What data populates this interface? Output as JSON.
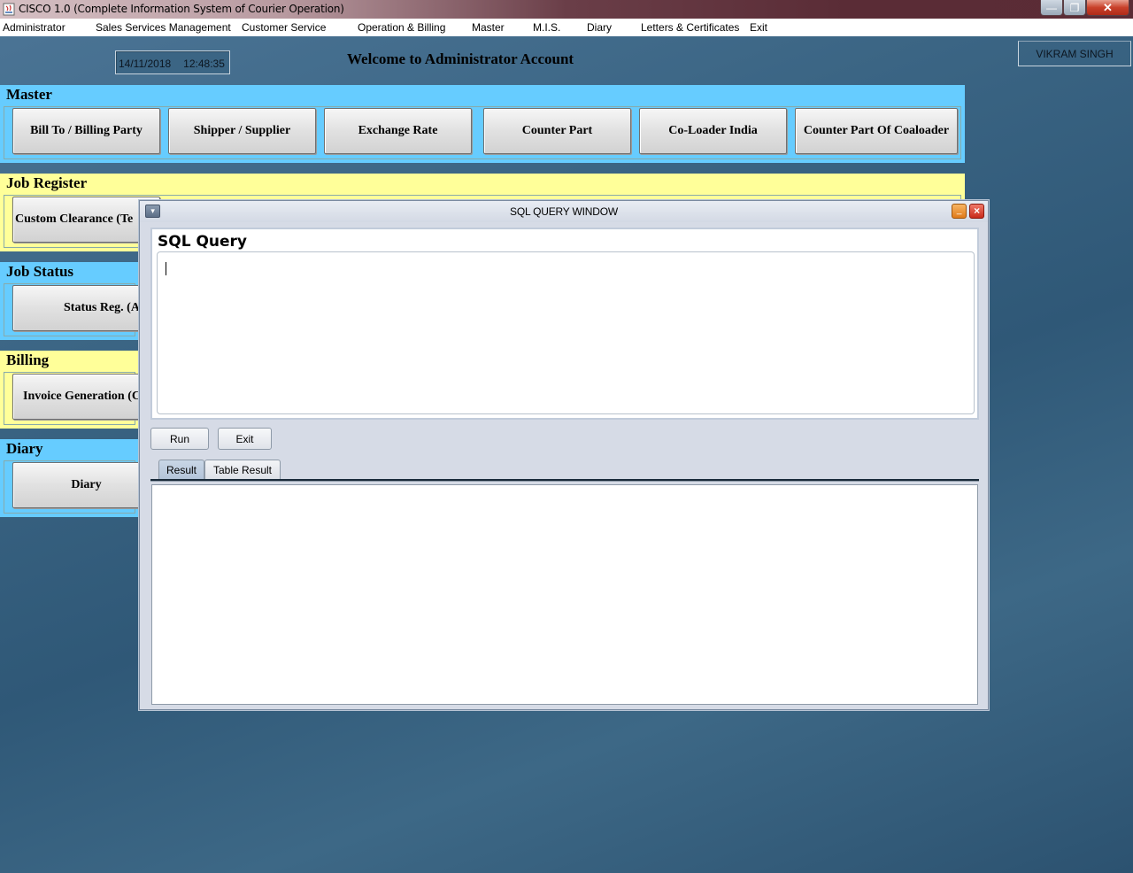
{
  "window": {
    "title": "CISCO 1.0 (Complete Information System of Courier Operation)",
    "min_label": "—",
    "max_label": "❐",
    "close_label": "✕"
  },
  "menu": [
    {
      "id": "administrator",
      "label": "Administrator"
    },
    {
      "id": "sales",
      "label": "Sales Services Management"
    },
    {
      "id": "customer",
      "label": "Customer Service"
    },
    {
      "id": "operation",
      "label": "Operation & Billing"
    },
    {
      "id": "master",
      "label": "Master"
    },
    {
      "id": "mis",
      "label": "M.I.S."
    },
    {
      "id": "diary",
      "label": "Diary"
    },
    {
      "id": "letters",
      "label": "Letters & Certificates"
    },
    {
      "id": "exit",
      "label": "Exit"
    }
  ],
  "header": {
    "date": "14/11/2018",
    "time": "12:48:35",
    "welcome": "Welcome to Administrator Account",
    "user": "VIKRAM SINGH"
  },
  "sections": {
    "master": {
      "title": "Master",
      "buttons": [
        "Bill To / Billing Party",
        "Shipper / Supplier",
        "Exchange Rate",
        "Counter Part",
        "Co-Loader India",
        "Counter Part Of Coaloader"
      ]
    },
    "job_register": {
      "title": "Job Register",
      "buttons": [
        "Custom Clearance (Te"
      ]
    },
    "job_status": {
      "title": "Job Status",
      "buttons": [
        "Status Reg. (A"
      ]
    },
    "billing": {
      "title": "Billing",
      "buttons": [
        "Invoice Generation (C"
      ]
    },
    "diary": {
      "title": "Diary",
      "buttons": [
        "Diary"
      ]
    }
  },
  "sql_window": {
    "title": "SQL QUERY WINDOW",
    "sysmenu_label": "▾",
    "min_label": "_",
    "close_label": "×",
    "query_label": "SQL Query",
    "query_value": "",
    "run_label": "Run",
    "exit_label": "Exit",
    "tabs": [
      {
        "label": "Result",
        "active": true
      },
      {
        "label": "Table Result",
        "active": false
      }
    ]
  },
  "colors": {
    "section_blue": "#66ccff",
    "section_yellow": "#ffff99",
    "desktop": "#3b6584"
  }
}
